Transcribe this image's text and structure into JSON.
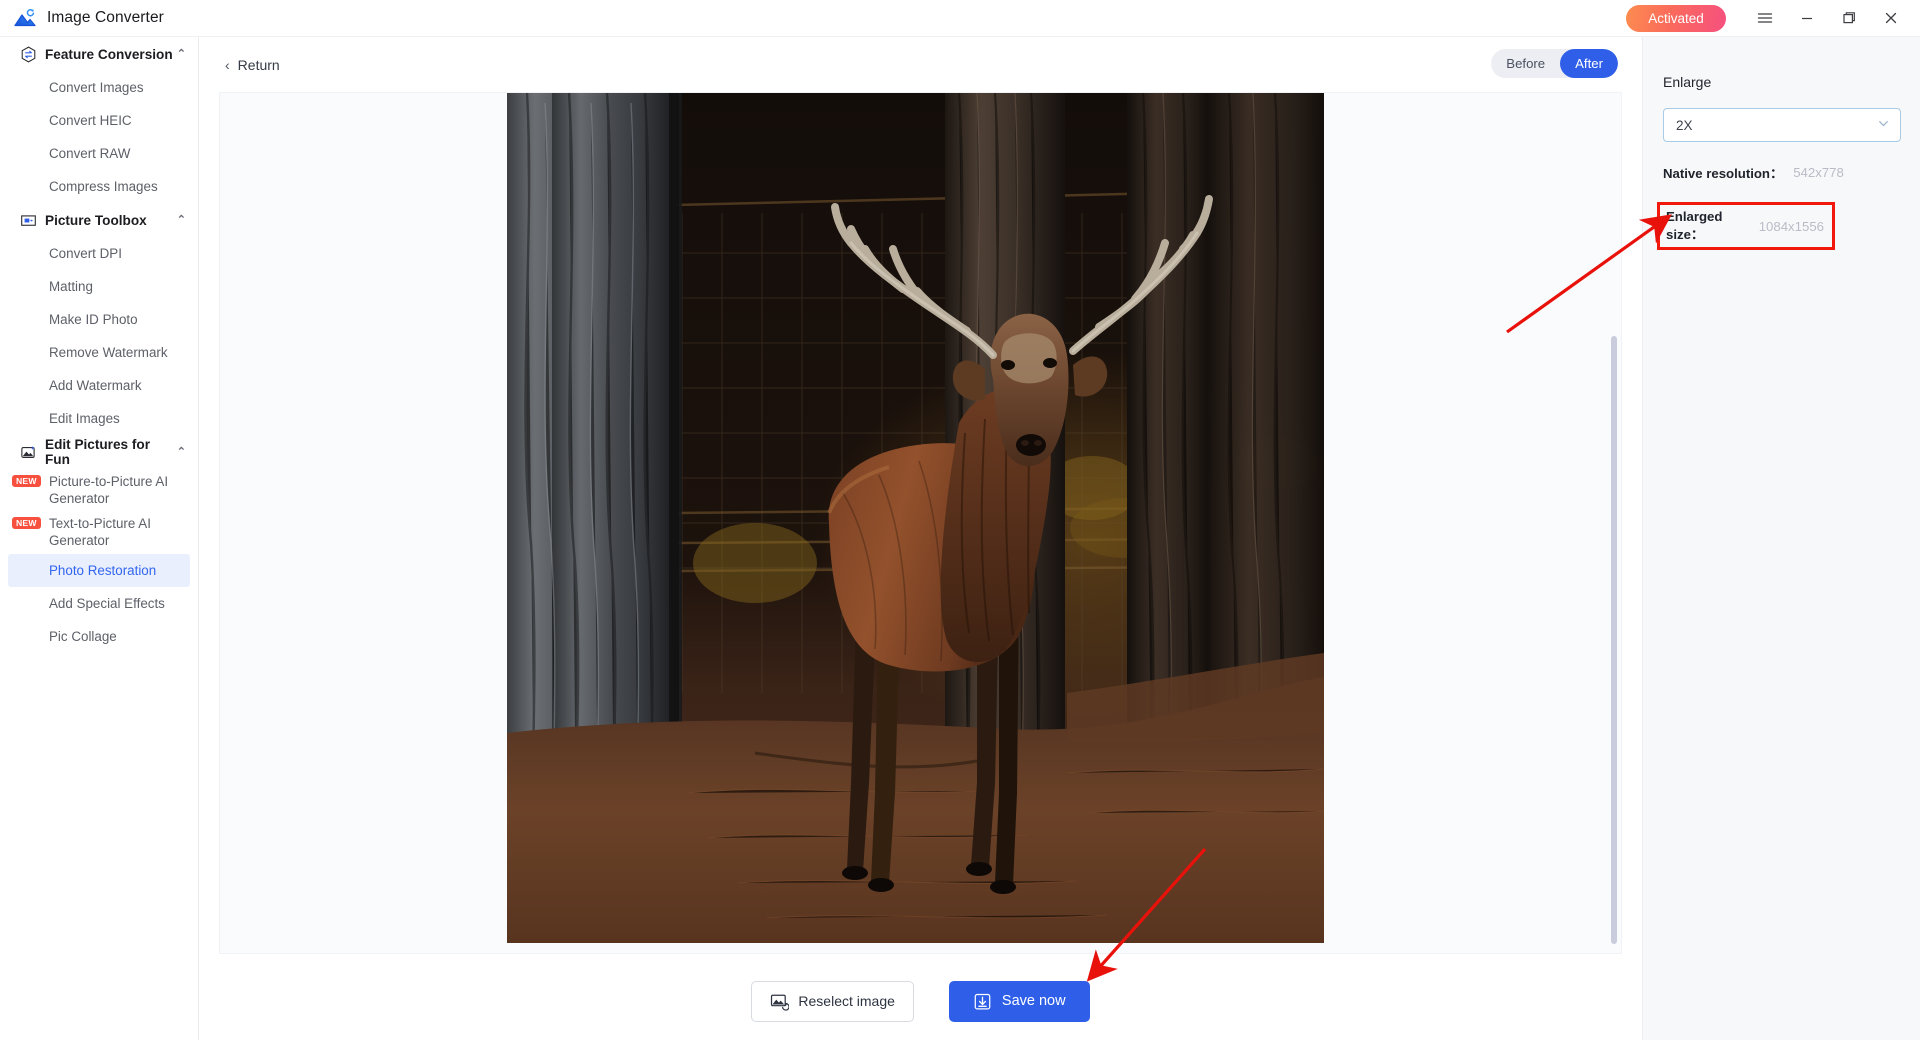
{
  "window": {
    "app_title": "Image Converter",
    "logo_icon": "image-converter-logo-icon",
    "activated_label": "Activated",
    "menu_icon": "hamburger-menu-icon",
    "minimize_icon": "minimize-icon",
    "maximize_icon": "maximize-restore-icon",
    "close_icon": "close-icon"
  },
  "sidebar": {
    "groups": [
      {
        "label": "Feature Conversion",
        "icon": "feature-conversion-icon",
        "caret": "⌃",
        "items": [
          {
            "label": "Convert Images",
            "badge": null,
            "selected": false
          },
          {
            "label": "Convert HEIC",
            "badge": null,
            "selected": false
          },
          {
            "label": "Convert RAW",
            "badge": null,
            "selected": false
          },
          {
            "label": "Compress Images",
            "badge": null,
            "selected": false
          }
        ]
      },
      {
        "label": "Picture Toolbox",
        "icon": "picture-toolbox-icon",
        "caret": "⌃",
        "items": [
          {
            "label": "Convert DPI",
            "badge": null,
            "selected": false
          },
          {
            "label": "Matting",
            "badge": null,
            "selected": false
          },
          {
            "label": "Make ID Photo",
            "badge": null,
            "selected": false
          },
          {
            "label": "Remove Watermark",
            "badge": null,
            "selected": false
          },
          {
            "label": "Add Watermark",
            "badge": null,
            "selected": false
          },
          {
            "label": "Edit Images",
            "badge": null,
            "selected": false
          }
        ]
      },
      {
        "label": "Edit Pictures for Fun",
        "icon": "edit-pictures-for-fun-icon",
        "caret": "⌃",
        "items": [
          {
            "label": "Picture-to-Picture AI Generator",
            "badge": "NEW",
            "selected": false
          },
          {
            "label": "Text-to-Picture AI Generator",
            "badge": "NEW",
            "selected": false
          },
          {
            "label": "Photo Restoration",
            "badge": null,
            "selected": true
          },
          {
            "label": "Add Special Effects",
            "badge": null,
            "selected": false
          },
          {
            "label": "Pic Collage",
            "badge": null,
            "selected": false
          }
        ]
      }
    ]
  },
  "main": {
    "return_label": "Return",
    "return_icon": "chevron-left-icon",
    "compare_toggle": {
      "before_label": "Before",
      "after_label": "After",
      "selected": "After"
    },
    "preview": {
      "alt": "enlarged photo of a red deer stag standing among pine trees in a dark forest",
      "scrollbar": "vertical-scrollbar"
    },
    "actions": {
      "reselect_label": "Reselect image",
      "reselect_icon": "reselect-image-icon",
      "save_label": "Save now",
      "save_icon": "download-icon"
    }
  },
  "right_panel": {
    "title": "Enlarge",
    "scale_select": {
      "value": "2X",
      "chevron_icon": "chevron-down-icon"
    },
    "native_resolution_label": "Native resolution：",
    "native_resolution_value": "542x778",
    "enlarged_size_label": "Enlarged size：",
    "enlarged_size_value": "1084x1556"
  },
  "annotations": {
    "highlight_box_color": "#f0190c",
    "arrow_color": "#e8120b",
    "arrow_1_target": "enlarged-size-row",
    "arrow_2_target": "save-now-button"
  },
  "colors": {
    "accent_blue": "#2f5fe8",
    "selected_item_bg": "#e9effd",
    "selected_item_text": "#3366f0",
    "badge_new": "#f7503f",
    "panel_bg": "#f7f8fa"
  }
}
